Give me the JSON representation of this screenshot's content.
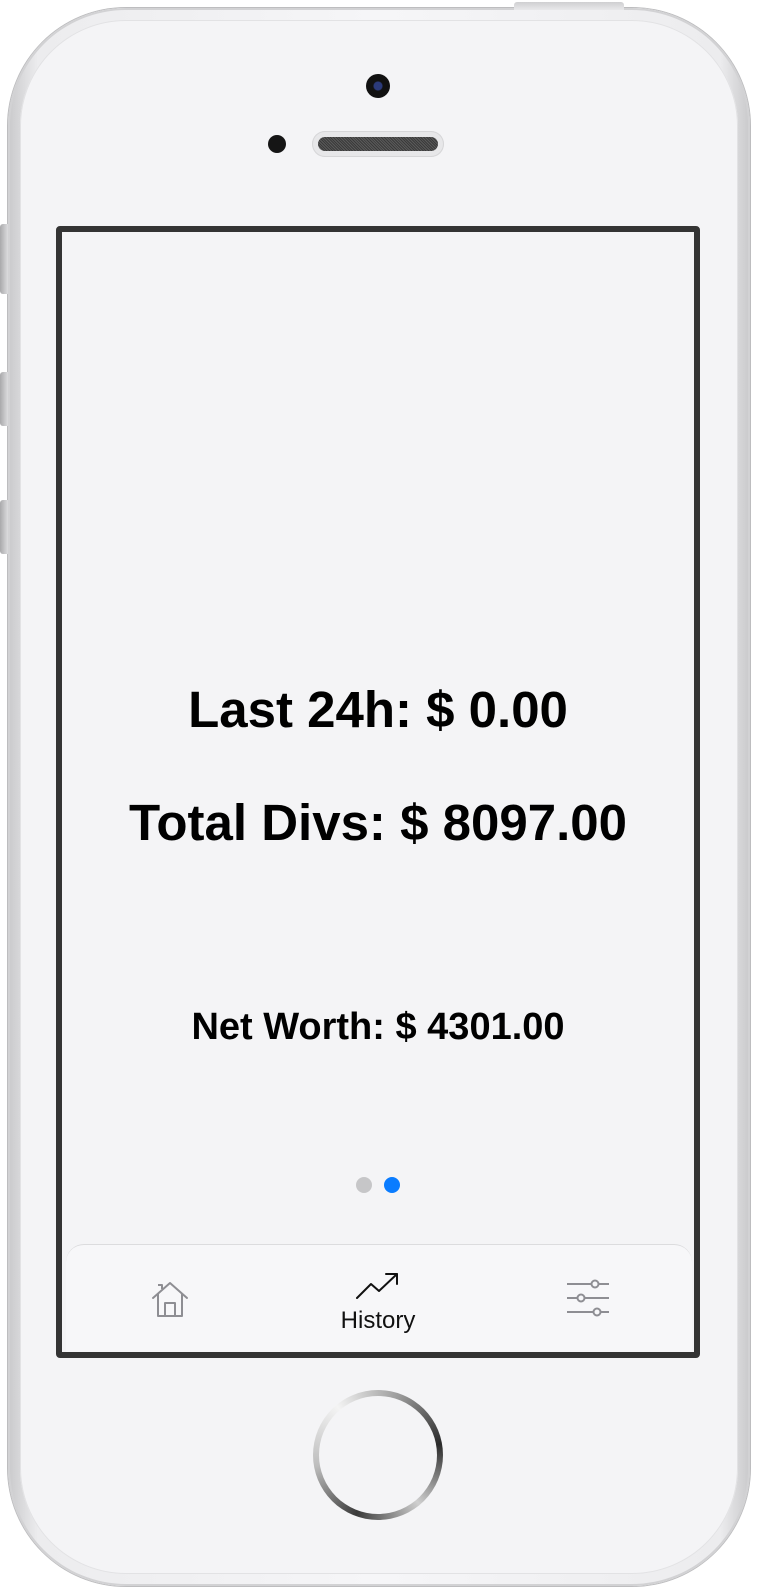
{
  "dashboard": {
    "last_24h": "Last 24h: $ 0.00",
    "total_divs": "Total Divs: $ 8097.00",
    "net_worth": "Net Worth: $ 4301.00"
  },
  "pager": {
    "page_count": 2,
    "active_page": 2,
    "active_color": "#0a7cff",
    "inactive_color": "#c6c6c8"
  },
  "tab_bar": {
    "tabs": [
      {
        "icon": "home-icon",
        "label": ""
      },
      {
        "icon": "trend-up-icon",
        "label": "History",
        "selected": true
      },
      {
        "icon": "sliders-icon",
        "label": ""
      }
    ]
  }
}
